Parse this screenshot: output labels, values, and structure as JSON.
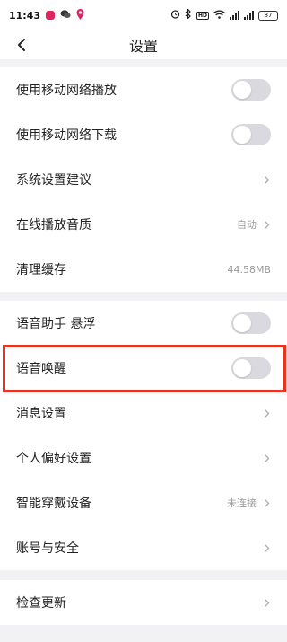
{
  "status_bar": {
    "time": "11:43",
    "hd_badge": "HD",
    "battery": "87",
    "network_1": "5G",
    "network_2": "5G",
    "app_icons": [
      "red-app-icon",
      "chat-icon",
      "location-icon"
    ]
  },
  "header": {
    "title": "设置"
  },
  "groups": [
    {
      "rows": [
        {
          "label": "使用移动网络播放",
          "type": "toggle",
          "on": false
        },
        {
          "label": "使用移动网络下载",
          "type": "toggle",
          "on": false
        },
        {
          "label": "系统设置建议",
          "type": "chevron"
        },
        {
          "label": "在线播放音质",
          "type": "value-chevron",
          "value": "自动"
        },
        {
          "label": "清理缓存",
          "type": "value",
          "value": "44.58MB"
        }
      ]
    },
    {
      "rows": [
        {
          "label": "语音助手 悬浮",
          "type": "toggle",
          "on": false
        },
        {
          "label": "语音唤醒",
          "type": "toggle",
          "on": false,
          "highlighted": true
        },
        {
          "label": "消息设置",
          "type": "chevron"
        },
        {
          "label": "个人偏好设置",
          "type": "chevron"
        },
        {
          "label": "智能穿戴设备",
          "type": "value-chevron",
          "value": "未连接"
        },
        {
          "label": "账号与安全",
          "type": "chevron"
        }
      ]
    },
    {
      "rows": [
        {
          "label": "检查更新",
          "type": "chevron"
        }
      ]
    }
  ],
  "colors": {
    "highlight_border": "#e8331f",
    "toggle_off": "#d9d9df",
    "secondary_text": "#9a9a9a"
  }
}
